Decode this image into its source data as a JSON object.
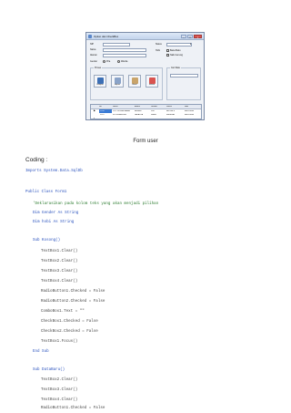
{
  "form": {
    "title": "Option dan CheckBox",
    "labels": {
      "nip": "NIP",
      "nama": "Nama",
      "alamat": "Alamat",
      "gender": "Gender",
      "status": "Status",
      "hobi": "Hobi"
    },
    "radios": [
      "Pria",
      "Wanita"
    ],
    "checkboxes": [
      "Baca Buku",
      "Naik Gunung"
    ],
    "groups": {
      "proses": "Proses",
      "cari": "Cari Data"
    },
    "buttons": [
      "Simpan",
      "Hapus",
      "Batal",
      "Keluar"
    ],
    "grid": {
      "columns": [
        "NIP",
        "Nama",
        "Alamat",
        "Gender",
        "Status",
        "Hobi"
      ],
      "rows": [
        [
          "1234",
          "1122 RUZAM BAHA",
          "BEKASI",
          "Pria",
          "BELUM M",
          "Baca Buku"
        ],
        [
          "2222",
          "FLOWSANDRA",
          "JAKARTA",
          "Wanita",
          "MENIKAH",
          "Baca Buku"
        ],
        [
          "",
          "",
          "",
          "",
          "",
          ""
        ]
      ]
    }
  },
  "caption": "Form user",
  "heading": "Coding :",
  "code": {
    "imports": "Imports System.Data.SqlDb",
    "class_decl": "Public Class Form1",
    "comment": "'Deklarasikan pada kolom teks yang akan menjadi pilihan",
    "dim1": "Dim Gender As String",
    "dim2": "Dim hobi As String",
    "sub_kosong": "Sub Kosong()",
    "k1": "TextBox1.Clear()",
    "k2": "TextBox2.Clear()",
    "k3": "TextBox3.Clear()",
    "k4": "TextBox4.Clear()",
    "k5": "RadioButton1.Checked = False",
    "k6": "RadioButton2.Checked = False",
    "k7": "ComboBox1.Text = \"\"",
    "k8": "CheckBox1.Checked = False",
    "k9": "CheckBox2.Checked = False",
    "k10": "TextBox1.Focus()",
    "end_sub": "End Sub",
    "sub_dataBaru": "Sub DataBaru()",
    "d1": "TextBox2.Clear()",
    "d2": "TextBox3.Clear()",
    "d3": "TextBox4.Clear()",
    "d4": "RadioButton1.Checked = False"
  },
  "colors": {
    "keyword": "#2a52be",
    "comment": "#2e7d32",
    "selection": "#3a7bd5"
  }
}
